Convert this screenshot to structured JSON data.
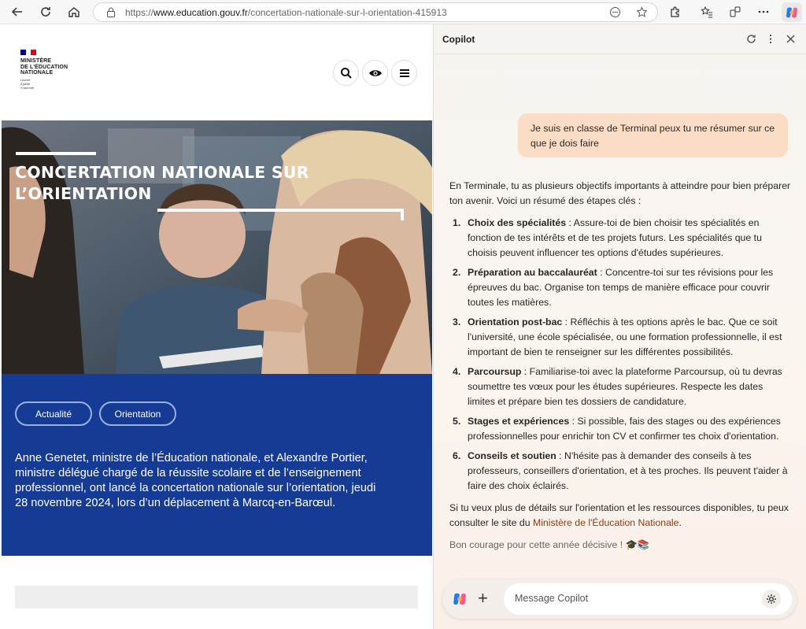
{
  "browser": {
    "url_prefix": "https://",
    "url_domain": "www.education.gouv.fr",
    "url_path": "/concertation-nationale-sur-l-orientation-415913"
  },
  "site": {
    "logo_lines": [
      "MINISTÈRE",
      "DE L'ÉDUCATION",
      "NATIONALE"
    ],
    "logo_motto": [
      "Liberté",
      "Égalité",
      "Fraternité"
    ],
    "hero_title": "CONCERTATION NATIONALE SUR L’ORIENTATION",
    "tags": [
      "Actualité",
      "Orientation"
    ],
    "lead": "Anne Genetet, ministre de l’Éducation nationale, et Alexandre Portier, ministre délégué chargé de la réussite scolaire et de l’enseignement professionnel, ont lancé la concertation nationale sur l’orientation, jeudi 28 novembre 2024, lors d’un déplacement à Marcq-en-Barœul."
  },
  "copilot": {
    "title": "Copilot",
    "user_message": "Je suis en classe de Terminal peux tu me résumer sur ce que je dois faire",
    "intro": "En Terminale, tu as plusieurs objectifs importants à atteindre pour bien préparer ton avenir. Voici un résumé des étapes clés :",
    "items": [
      {
        "num": "1.",
        "title": "Choix des spécialités",
        "text": " : Assure-toi de bien choisir tes spécialités en fonction de tes intérêts et de tes projets futurs. Les spécialités que tu choisis peuvent influencer tes options d'études supérieures."
      },
      {
        "num": "2.",
        "title": "Préparation au baccalauréat",
        "text": " : Concentre-toi sur tes révisions pour les épreuves du bac. Organise ton temps de manière efficace pour couvrir toutes les matières."
      },
      {
        "num": "3.",
        "title": "Orientation post-bac",
        "text": " : Réfléchis à tes options après le bac. Que ce soit l'université, une école spécialisée, ou une formation professionnelle, il est important de bien te renseigner sur les différentes possibilités."
      },
      {
        "num": "4.",
        "title": "Parcoursup",
        "text": " : Familiarise-toi avec la plateforme Parcoursup, où tu devras soumettre tes vœux pour les études supérieures. Respecte les dates limites et prépare bien tes dossiers de candidature."
      },
      {
        "num": "5.",
        "title": "Stages et expériences",
        "text": " : Si possible, fais des stages ou des expériences professionnelles pour enrichir ton CV et confirmer tes choix d'orientation."
      },
      {
        "num": "6.",
        "title": "Conseils et soutien",
        "text": " : N'hésite pas à demander des conseils à tes professeurs, conseillers d'orientation, et à tes proches. Ils peuvent t'aider à faire des choix éclairés."
      }
    ],
    "outro_before": "Si tu veux plus de détails sur l'orientation et les ressources disponibles, tu peux consulter le site du ",
    "outro_link": "Ministère de l'Éducation Nationale",
    "outro_after": ".",
    "closing": "Bon courage pour cette année décisive ! 🎓📚",
    "composer_placeholder": "Message Copilot"
  }
}
